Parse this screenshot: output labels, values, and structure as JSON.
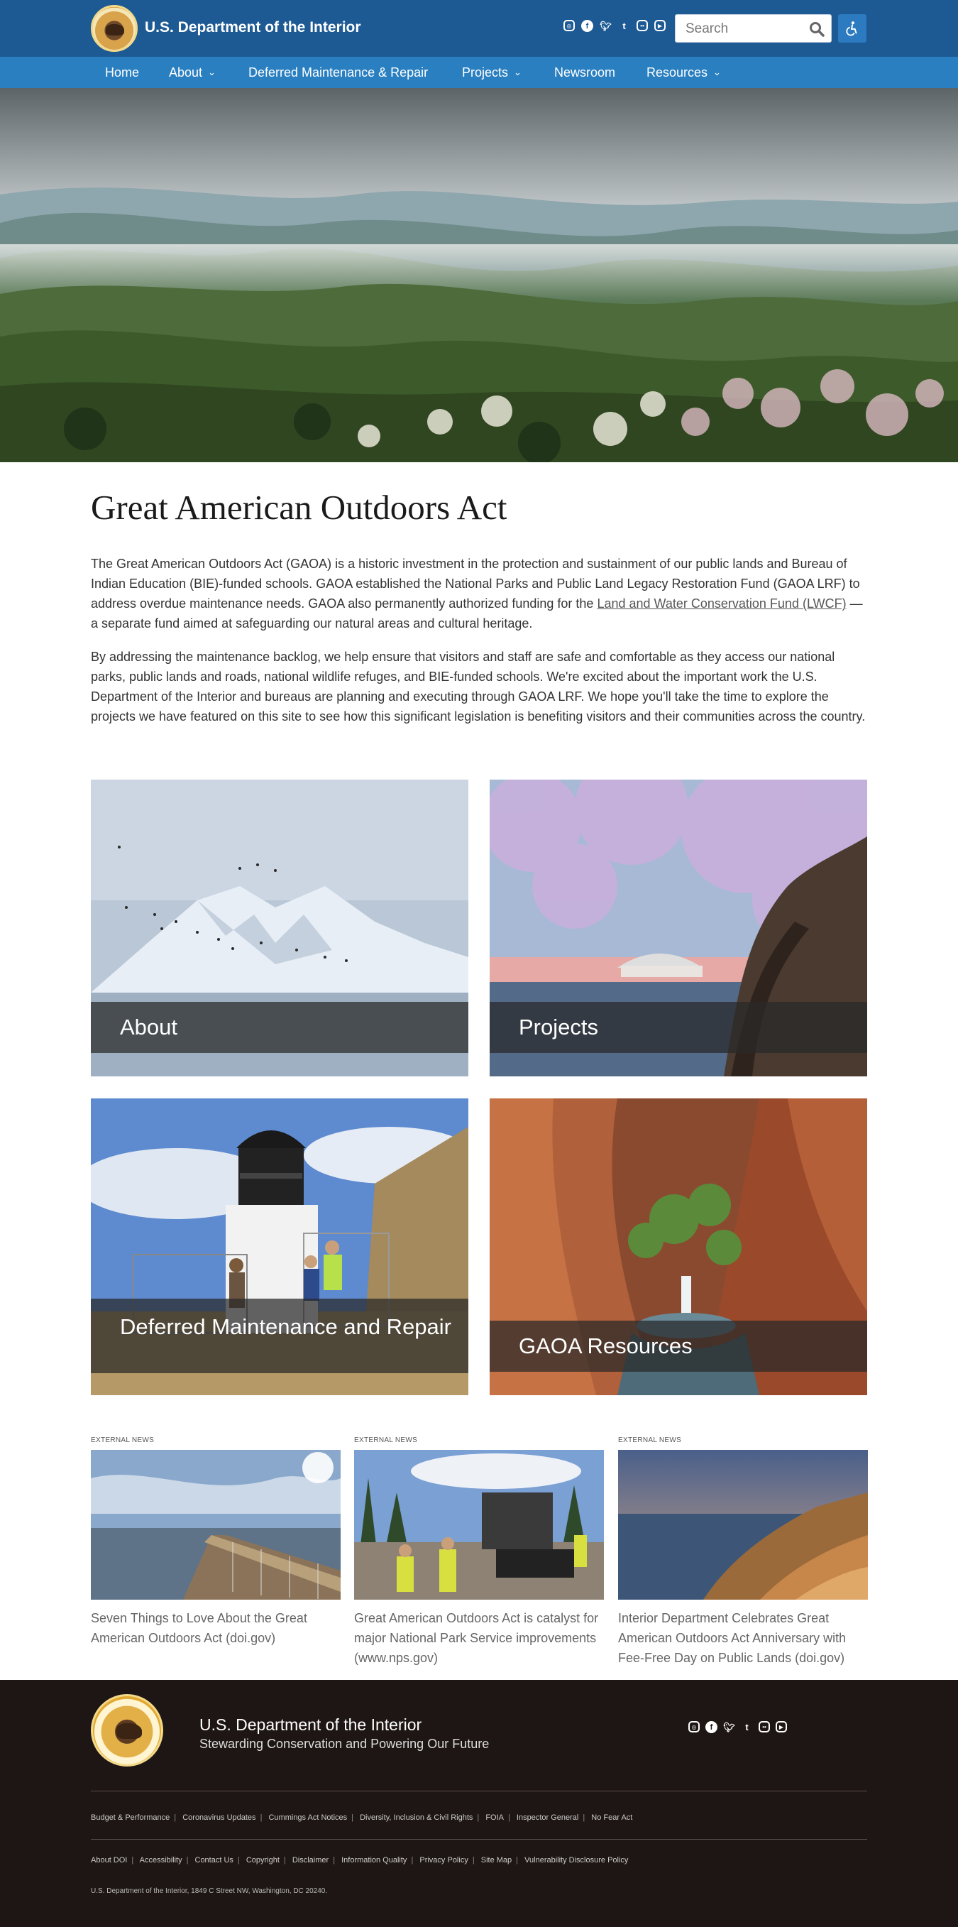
{
  "header": {
    "site_title": "U.S. Department of the Interior",
    "search_placeholder": "Search",
    "social_icons": [
      "instagram-icon",
      "facebook-icon",
      "twitter-icon",
      "tumblr-icon",
      "flickr-icon",
      "youtube-icon"
    ],
    "accessibility_icon": "accessibility-icon"
  },
  "nav": {
    "items": [
      {
        "label": "Home",
        "has_dropdown": false
      },
      {
        "label": "About",
        "has_dropdown": true
      },
      {
        "label": "Deferred Maintenance & Repair",
        "has_dropdown": false
      },
      {
        "label": "Projects",
        "has_dropdown": true
      },
      {
        "label": "Newsroom",
        "has_dropdown": false
      },
      {
        "label": "Resources",
        "has_dropdown": true
      }
    ]
  },
  "main": {
    "title": "Great American Outdoors Act",
    "para1_start": "The Great American Outdoors Act (GAOA) is a historic investment in the protection and sustainment of our public lands and Bureau of Indian Education (BIE)-funded schools. GAOA established the National Parks and Public Land Legacy Restoration Fund (GAOA LRF) to address overdue maintenance needs. GAOA also permanently authorized funding for the ",
    "para1_link": "Land and Water Conservation Fund (LWCF)",
    "para1_end": " — a separate fund aimed at safeguarding our natural areas and cultural heritage.",
    "para2": "By addressing the maintenance backlog, we help ensure that visitors and staff are safe and comfortable as they access our national parks, public lands and roads, national wildlife refuges, and BIE-funded schools. We're excited about the important work the U.S. Department of the Interior and bureaus are planning and executing through GAOA LRF. We hope you'll take the time to explore the projects we have featured on this site to see how this significant legislation is benefiting visitors and their communities across the country."
  },
  "cards": [
    {
      "label": "About"
    },
    {
      "label": "Projects"
    },
    {
      "label": "Deferred Maintenance and Repair"
    },
    {
      "label": "GAOA Resources"
    }
  ],
  "news": [
    {
      "kicker": "EXTERNAL NEWS",
      "title": "Seven Things to Love About the Great American Outdoors Act (doi.gov)"
    },
    {
      "kicker": "EXTERNAL NEWS",
      "title": "Great American Outdoors Act is catalyst for major National Park Service improvements (www.nps.gov)"
    },
    {
      "kicker": "EXTERNAL NEWS",
      "title": "Interior Department Celebrates Great American Outdoors Act Anniversary with Fee-Free Day on Public Lands (doi.gov)"
    }
  ],
  "footer": {
    "title": "U.S. Department of the Interior",
    "tagline": "Stewarding Conservation and Powering Our Future",
    "links_row1": [
      "Budget & Performance",
      "Coronavirus Updates",
      "Cummings Act Notices",
      "Diversity, Inclusion & Civil Rights",
      "FOIA",
      "Inspector General",
      "No Fear Act"
    ],
    "links_row2": [
      "About DOI",
      "Accessibility",
      "Contact Us",
      "Copyright",
      "Disclaimer",
      "Information Quality",
      "Privacy Policy",
      "Site Map",
      "Vulnerability Disclosure Policy"
    ],
    "address": "U.S. Department of the Interior, 1849 C Street NW, Washington, DC 20240."
  },
  "colors": {
    "header_bg": "#1d5a94",
    "nav_bg": "#2a7fc1",
    "footer_bg": "#1e1614"
  }
}
